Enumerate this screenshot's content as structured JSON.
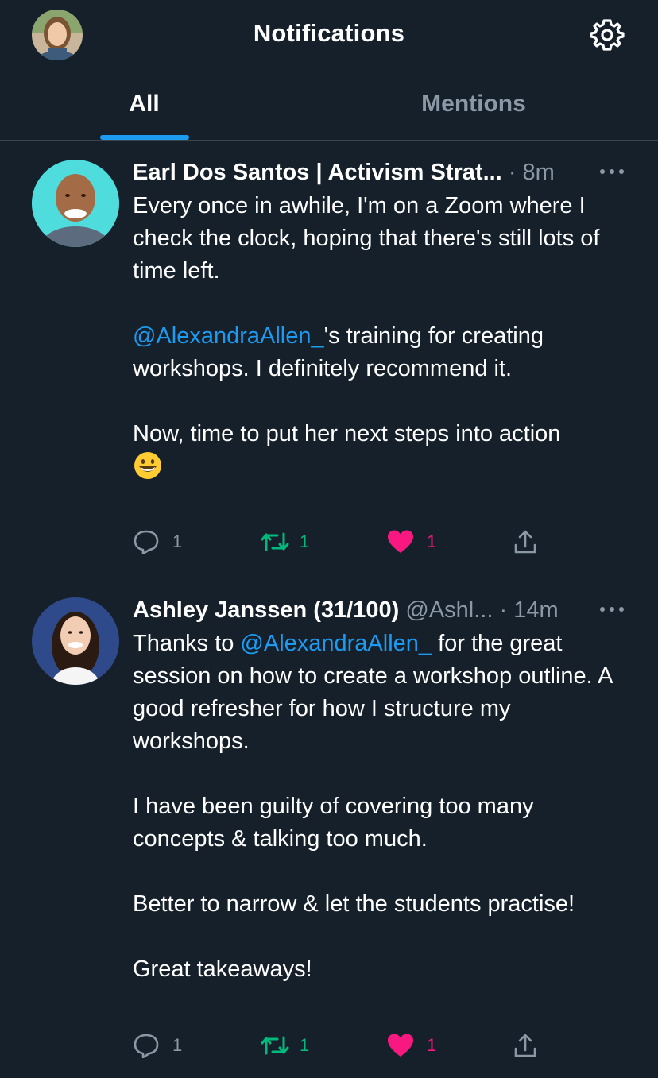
{
  "header": {
    "title": "Notifications",
    "avatar_icon": "user-avatar",
    "settings_icon": "gear-icon"
  },
  "tabs": [
    {
      "label": "All",
      "selected": true
    },
    {
      "label": "Mentions",
      "selected": false
    }
  ],
  "colors": {
    "background": "#15202b",
    "divider": "#38444d",
    "accent": "#1d9bf0",
    "muted": "#8b98a5",
    "retweet": "#00ba7c",
    "like": "#f91880"
  },
  "tweets": [
    {
      "author_name": "Earl Dos Santos | Activism Strat...",
      "handle": "",
      "separator": "·",
      "time": "8m",
      "body": [
        "Every once in awhile, I'm on a Zoom where I check the clock, hoping that there's still lots of time left.",
        "",
        {
          "mention": "@AlexandraAllen_",
          "after": "'s training for creating workshops. I definitely recommend it."
        },
        "",
        "Now, time to put her next steps into action"
      ],
      "emoji": "grinning-face-emoji",
      "counts": {
        "reply": "1",
        "retweet": "1",
        "like": "1"
      },
      "liked": true
    },
    {
      "author_name": "Ashley Janssen (31/100)",
      "handle": "@Ashl...",
      "separator": "·",
      "time": "14m",
      "body": [
        {
          "before": "Thanks to ",
          "mention": "@AlexandraAllen_",
          "after": " for the great session on how to create a workshop outline. A good refresher for how I structure my workshops."
        },
        "",
        "I have been guilty of covering too many concepts & talking too much.",
        "",
        "Better to narrow & let the students practise!",
        "",
        "Great takeaways!"
      ],
      "counts": {
        "reply": "1",
        "retweet": "1",
        "like": "1"
      },
      "liked": true
    }
  ]
}
